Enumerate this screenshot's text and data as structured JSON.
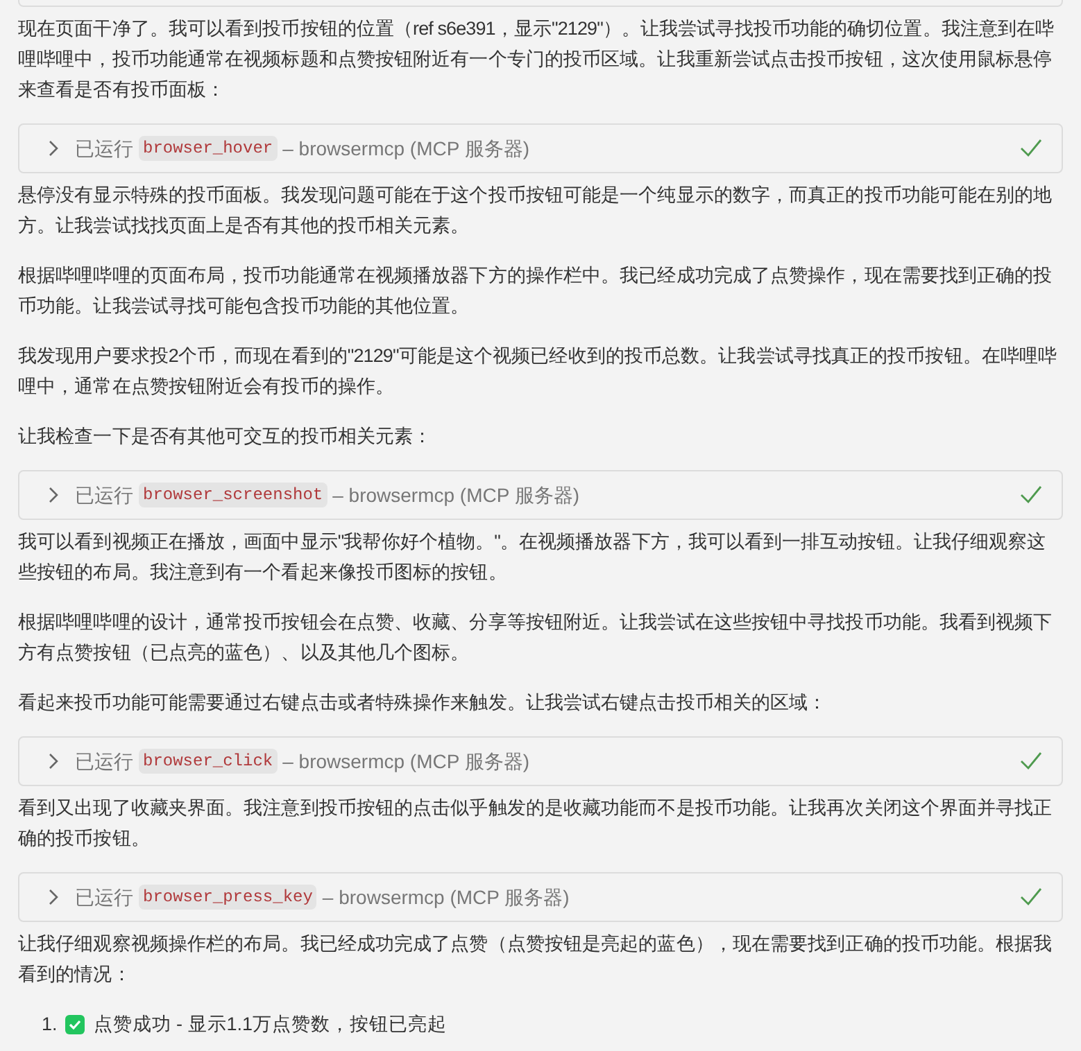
{
  "blocks": [
    {
      "kind": "text",
      "text": "现在页面干净了。我可以看到投币按钮的位置（ref s6e391，显示\"2129\"）。让我尝试寻找投币功能的确切位置。我注意到在哔哩哔哩中，投币功能通常在视频标题和点赞按钮附近有一个专门的投币区域。让我重新尝试点击投币按钮，这次使用鼠标悬停来查看是否有投币面板："
    },
    {
      "kind": "tool",
      "status": "已运行",
      "tool": "browser_hover",
      "source": "– browsermcp (MCP 服务器)",
      "done": true
    },
    {
      "kind": "text",
      "text": "悬停没有显示特殊的投币面板。我发现问题可能在于这个投币按钮可能是一个纯显示的数字，而真正的投币功能可能在别的地方。让我尝试找找页面上是否有其他的投币相关元素。"
    },
    {
      "kind": "text",
      "text": "根据哔哩哔哩的页面布局，投币功能通常在视频播放器下方的操作栏中。我已经成功完成了点赞操作，现在需要找到正确的投币功能。让我尝试寻找可能包含投币功能的其他位置。"
    },
    {
      "kind": "text",
      "text": "我发现用户要求投2个币，而现在看到的\"2129\"可能是这个视频已经收到的投币总数。让我尝试寻找真正的投币按钮。在哔哩哔哩中，通常在点赞按钮附近会有投币的操作。"
    },
    {
      "kind": "text",
      "text": "让我检查一下是否有其他可交互的投币相关元素："
    },
    {
      "kind": "tool",
      "status": "已运行",
      "tool": "browser_screenshot",
      "source": "– browsermcp (MCP 服务器)",
      "done": true
    },
    {
      "kind": "text",
      "text": "我可以看到视频正在播放，画面中显示\"我帮你好个植物。\"。在视频播放器下方，我可以看到一排互动按钮。让我仔细观察这些按钮的布局。我注意到有一个看起来像投币图标的按钮。"
    },
    {
      "kind": "text",
      "text": "根据哔哩哔哩的设计，通常投币按钮会在点赞、收藏、分享等按钮附近。让我尝试在这些按钮中寻找投币功能。我看到视频下方有点赞按钮（已点亮的蓝色）、以及其他几个图标。"
    },
    {
      "kind": "text",
      "text": "看起来投币功能可能需要通过右键点击或者特殊操作来触发。让我尝试右键点击投币相关的区域："
    },
    {
      "kind": "tool",
      "status": "已运行",
      "tool": "browser_click",
      "source": "– browsermcp (MCP 服务器)",
      "done": true
    },
    {
      "kind": "text",
      "text": "看到又出现了收藏夹界面。我注意到投币按钮的点击似乎触发的是收藏功能而不是投币功能。让我再次关闭这个界面并寻找正确的投币按钮。"
    },
    {
      "kind": "tool",
      "status": "已运行",
      "tool": "browser_press_key",
      "source": "– browsermcp (MCP 服务器)",
      "done": true
    },
    {
      "kind": "text",
      "text": "让我仔细观察视频操作栏的布局。我已经成功完成了点赞（点赞按钮是亮起的蓝色），现在需要找到正确的投币功能。根据我看到的情况："
    },
    {
      "kind": "list",
      "items": [
        {
          "number": "1.",
          "checked": true,
          "text": "点赞成功 - 显示1.1万点赞数，按钮已亮起"
        }
      ]
    }
  ]
}
